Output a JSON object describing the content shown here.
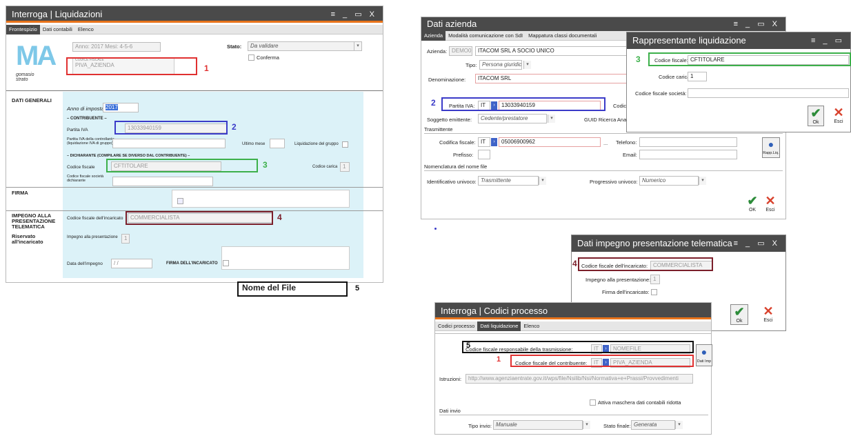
{
  "w1": {
    "title": "Interroga  |  Liquidazioni",
    "ctrls": "≡ _ ▭ X",
    "tabs": [
      "Frontespizio",
      "Dati contabili",
      "Elenco"
    ],
    "logo_text": "MA",
    "logo_sub": "gomasio\nstrato",
    "anno": "Anno: 2017 Mesi: 4-5-6",
    "cf_label": "CODICE FISCALE",
    "cf_value": "PIVA_AZIENDA",
    "stato_label": "Stato:",
    "stato_value": "Da validare",
    "conferma": "Conferma",
    "sections": {
      "dati_generali": "DATI GENERALI",
      "firma": "FIRMA",
      "impegno": "IMPEGNO ALLA PRESENTAZIONE TELEMATICA",
      "riservato": "Riservato all'incaricato"
    },
    "anno_imposta_label": "Anno di imposta",
    "anno_imposta_value": "2017",
    "contribuente": "– CONTRIBUENTE –",
    "partita_iva_label": "Partita IVA",
    "partita_iva_value": "13033940159",
    "piva_controllante": "Partita IVA della controllante (liquidazione IVA di gruppo)",
    "ultimo_mese": "Ultimo mese",
    "liq_gruppo": "Liquidazione del gruppo",
    "dichiarante": "– DICHIARANTE (COMPILARE SE DIVERSO DAL CONTRIBUENTE) –",
    "cf_dich_label": "Codice fiscale",
    "cf_dich_value": "CFTITOLARE",
    "codice_carica_label": "Codice carica",
    "codice_carica_value": "1",
    "cf_societa": "Codice fiscale società dichiarante",
    "cf_incaricato_label": "Codice fiscale dell'incaricato",
    "cf_incaricato_value": "COMMERCIALISTA",
    "impegno_pres_label": "Impegno alla presentazione",
    "impegno_pres_value": "1",
    "data_impegno_label": "Data dell'impegno",
    "data_impegno_value": "/ /",
    "firma_incaricato": "FIRMA DELL'INCARICATO"
  },
  "nome_file_label": "Nome del File",
  "markers": {
    "n1": "1",
    "n2": "2",
    "n3": "3",
    "n4": "4",
    "n5": "5"
  },
  "w2": {
    "title": "Dati azienda",
    "ctrls": "≡ _ ▭ X",
    "tabs": [
      "Azienda",
      "Modalità comunicazione con SdI",
      "Mappatura classi documentali"
    ],
    "azienda_label": "Azienda:",
    "azienda_code": "DEMO0",
    "azienda_name": "ITACOM SRL A SOCIO UNICO",
    "tipo_label": "Tipo:",
    "tipo_value": "Persona giuridica",
    "denominazione_label": "Denominazione:",
    "denominazione_value": "ITACOM SRL",
    "piva_label": "Partita IVA:",
    "piva_country": "IT",
    "piva_value": "13033940159",
    "codice_trunc": "Codic",
    "soggetto_label": "Soggetto emittente:",
    "soggetto_value": "Cedente/prestatore",
    "guid_label": "GUID Ricerca Anag",
    "trasmittente": "Trasmittente",
    "codifica_label": "Codifica fiscale:",
    "codifica_country": "IT",
    "codifica_value": "05006900962",
    "ellipsis": "...",
    "telefono_label": "Telefono:",
    "prefisso_label": "Prefisso:",
    "email_label": "Email:",
    "rapp_liq": "Rapp.Liq.",
    "nomenclatura": "Nomenclatura del nome file",
    "id_univoco_label": "Identificativo univoco:",
    "id_univoco_value": "Trasmittente",
    "prog_univoco_label": "Progressivo univoco:",
    "prog_univoco_value": "Numerico",
    "ok": "OK",
    "esci": "Esci"
  },
  "w3": {
    "title": "Rappresentante liquidazione",
    "ctrls": "≡ _ ▭",
    "cf_label": "Codice fiscale:",
    "cf_value": "CFTITOLARE",
    "carica_label": "Codice carica:",
    "carica_value": "1",
    "cf_societa_label": "Codice fiscale società:",
    "ok": "Ok",
    "esci": "Esci"
  },
  "w4": {
    "title": "Dati impegno presentazione telematica",
    "ctrls": "≡ _ ▭ X",
    "cf_label": "Codice fiscale dell'incaricato:",
    "cf_value": "COMMERCIALISTA",
    "impegno_label": "Impegno alla presentazione:",
    "impegno_value": "1",
    "firma_label": "Firma dell'incaricato:",
    "ok": "Ok",
    "esci": "Esci"
  },
  "w5": {
    "title": "Interroga  |  Codici processo",
    "tabs": [
      "Codici processo",
      "Dati liquidazione",
      "Elenco"
    ],
    "resp_label": "Codice fiscale responsabile della trasmissione:",
    "resp_country": "IT",
    "resp_value": "NOMEFILE",
    "contr_label": "Codice fiscale del contribuente:",
    "contr_country": "IT",
    "contr_value": "PIVA_AZIENDA",
    "dati_imp": "Dati Imp",
    "istruzioni_label": "Istruzioni:",
    "istruzioni_value": "http://www.agenziaentrate.gov.it/wps/file/Nsilib/Nsi/Normativa+e+Prassi/Provvedimenti",
    "attiva": "Attiva maschera dati contabili ridotta",
    "dati_invio": "Dati invio",
    "tipo_invio_label": "Tipo invio:",
    "tipo_invio_value": "Manuale",
    "stato_finale_label": "Stato finale:",
    "stato_finale_value": "Generata"
  },
  "colors": {
    "red": "#e03030",
    "blue": "#3a3ac8",
    "green": "#3cb04a",
    "maroon": "#7b1f2a",
    "titlebar": "#4a4a4a",
    "accent": "#e8731a",
    "panel": "#dcf2f8"
  }
}
